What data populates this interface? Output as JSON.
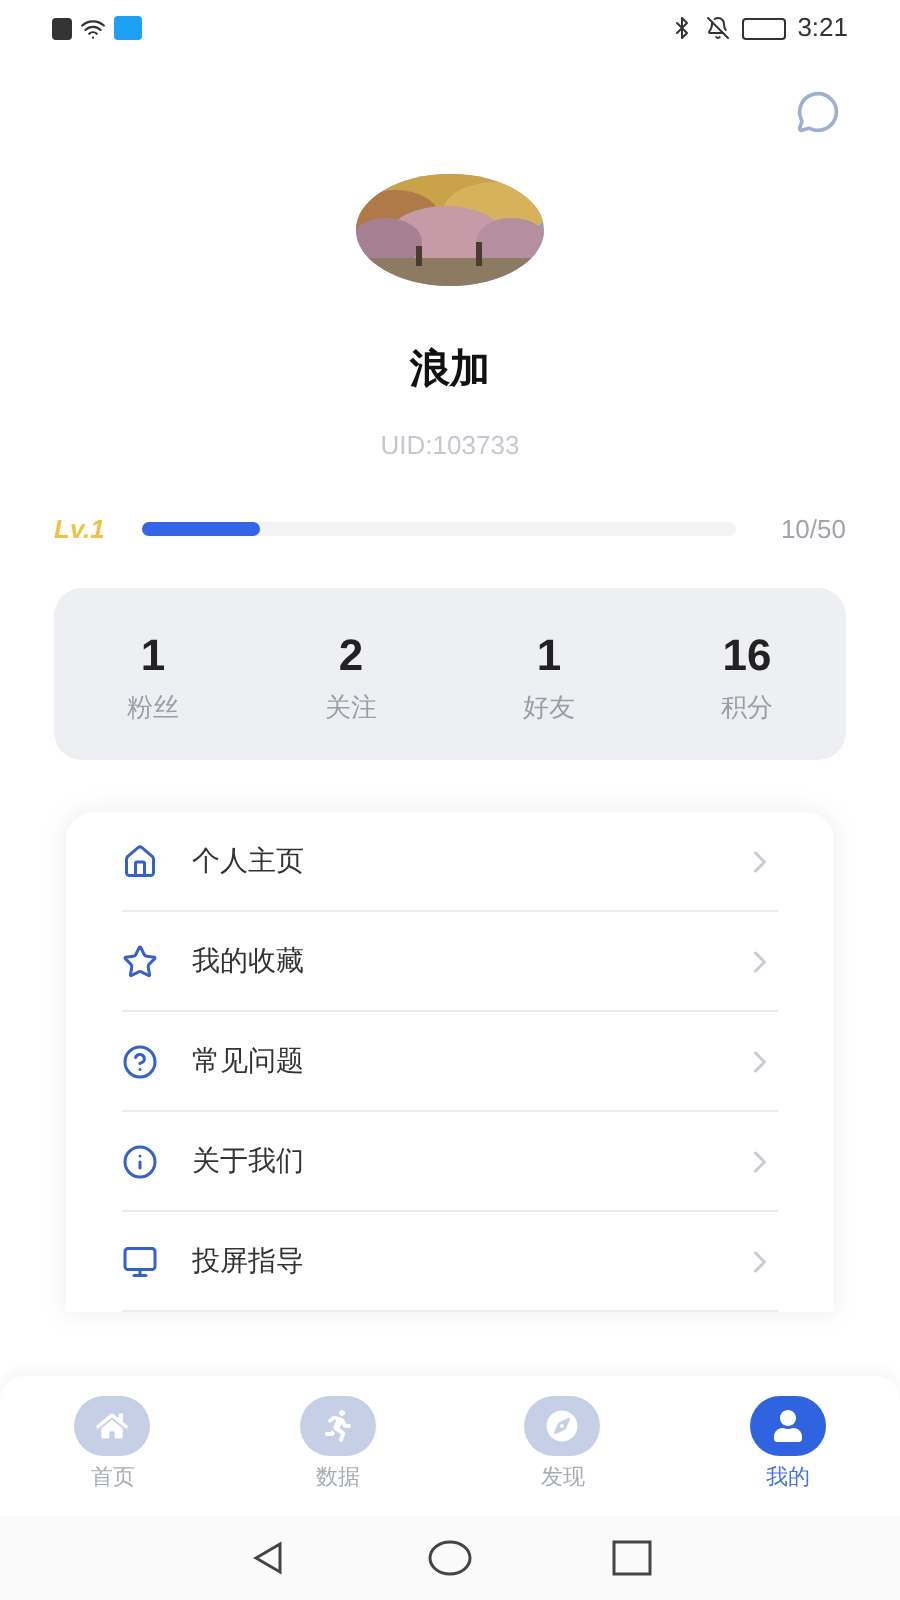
{
  "status_bar": {
    "time": "3:21"
  },
  "profile": {
    "name": "浪加",
    "uid": "UID:103733"
  },
  "level": {
    "label": "Lv.1",
    "level": 0.2,
    "progress": "10/50"
  },
  "stats": [
    {
      "value": "1",
      "label": "粉丝"
    },
    {
      "value": "2",
      "label": "关注"
    },
    {
      "value": "1",
      "label": "好友"
    },
    {
      "value": "16",
      "label": "积分"
    }
  ],
  "menu": [
    {
      "label": "个人主页"
    },
    {
      "label": "我的收藏"
    },
    {
      "label": "常见问题"
    },
    {
      "label": "关于我们"
    },
    {
      "label": "投屏指导"
    }
  ],
  "tab_bar": [
    {
      "label": "首页",
      "selected": false
    },
    {
      "label": "数据",
      "selected": false
    },
    {
      "label": "发现",
      "selected": false
    },
    {
      "label": "我的",
      "selected": true
    }
  ]
}
